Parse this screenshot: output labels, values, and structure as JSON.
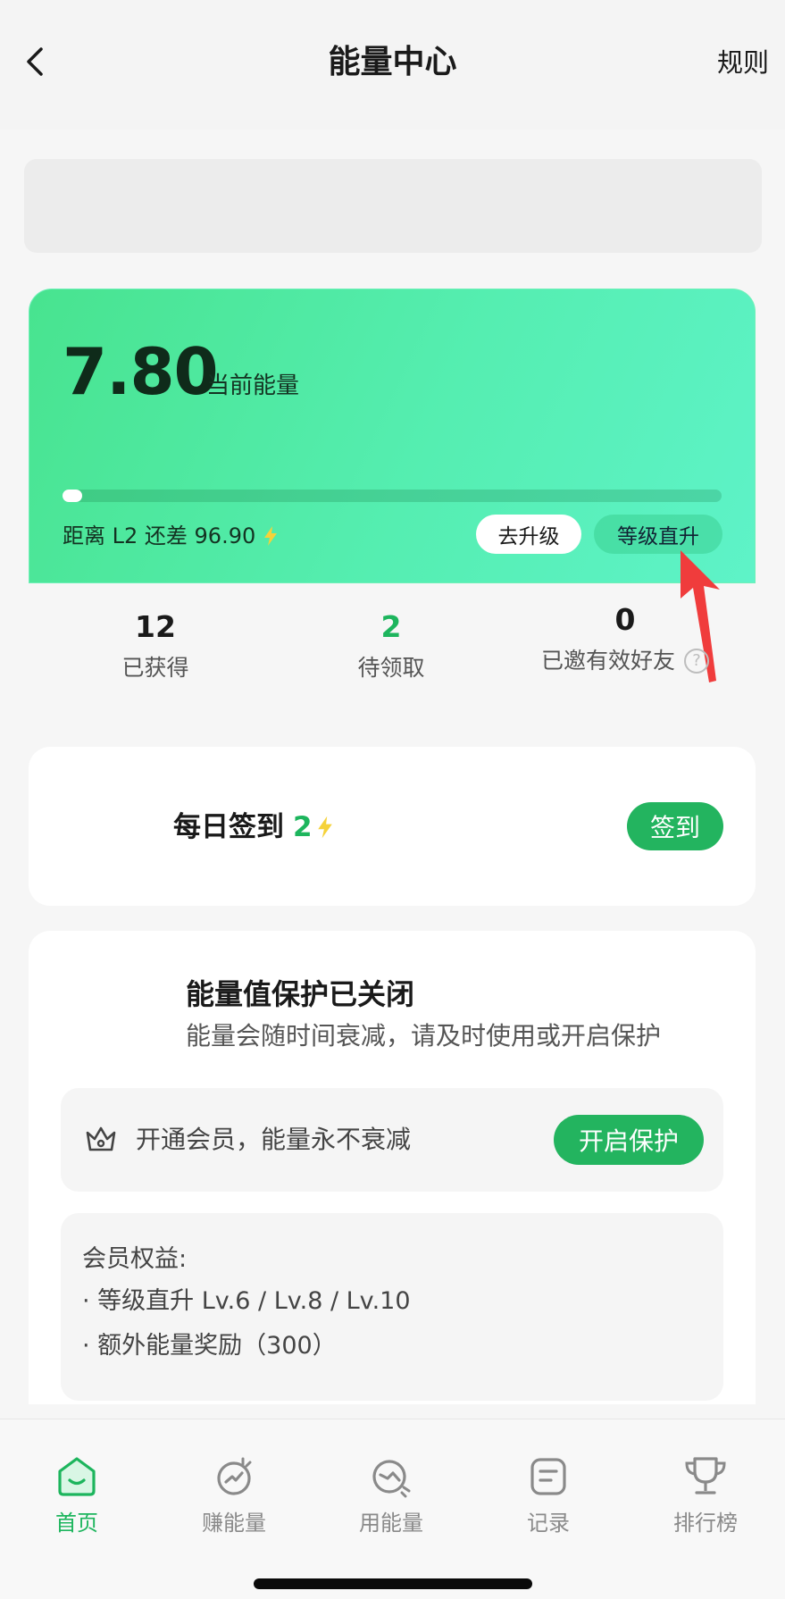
{
  "header": {
    "title": "能量中心",
    "rules_label": "规则"
  },
  "energy": {
    "value": "7.80",
    "label": "当前能量",
    "progress_fraction": 0.03,
    "distance_prefix": "距离 L2 还差 96.90",
    "upgrade_label": "去升级",
    "levelup_label": "等级直升"
  },
  "stats": [
    {
      "value": "12",
      "label": "已获得"
    },
    {
      "value": "2",
      "label": "待领取"
    },
    {
      "value": "0",
      "label": "已邀有效好友"
    }
  ],
  "checkin": {
    "title": "每日签到",
    "reward": "2",
    "button_label": "签到"
  },
  "protection": {
    "title": "能量值保护已关闭",
    "description": "能量会随时间衰减，请及时使用或开启保护",
    "member_text": "开通会员，能量永不衰减",
    "enable_label": "开启保护",
    "benefits_title": "会员权益:",
    "benefits": [
      "· 等级直升 Lv.6 / Lv.8 / Lv.10",
      "· 额外能量奖励（300）"
    ]
  },
  "tabs": [
    {
      "label": "首页",
      "icon": "home-icon",
      "active": true
    },
    {
      "label": "赚能量",
      "icon": "earn-energy-icon",
      "active": false
    },
    {
      "label": "用能量",
      "icon": "use-energy-icon",
      "active": false
    },
    {
      "label": "记录",
      "icon": "record-icon",
      "active": false
    },
    {
      "label": "排行榜",
      "icon": "trophy-icon",
      "active": false
    }
  ],
  "colors": {
    "accent": "#1db55d",
    "button_green": "#23b45f",
    "card_gradient_start": "#48e38f",
    "card_gradient_end": "#5ef3c8",
    "arrow_red": "#f03c3c"
  }
}
